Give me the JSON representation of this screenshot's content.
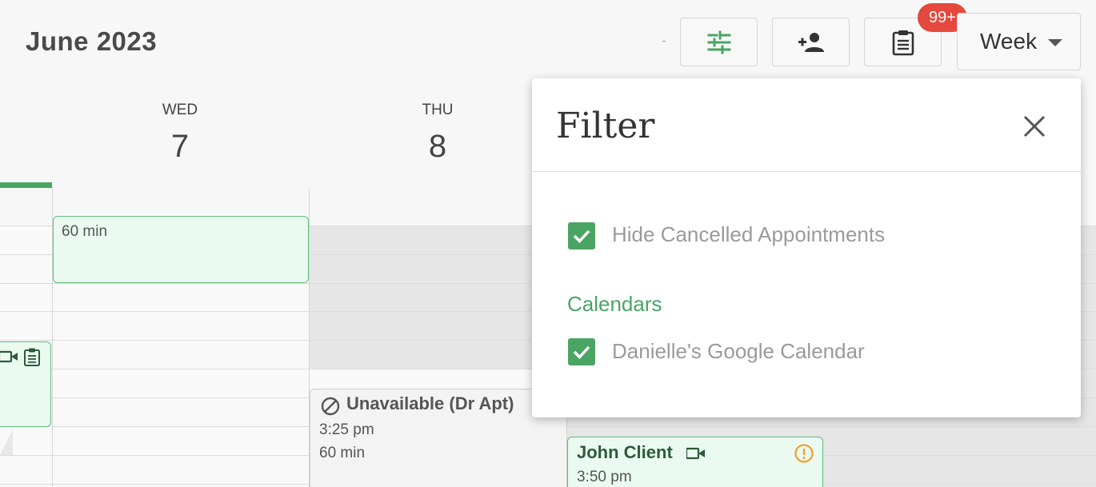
{
  "header": {
    "title": "June 2023",
    "notification_count": "99+",
    "view_selector": "Week"
  },
  "days": [
    {
      "name": "WED",
      "number": "7"
    },
    {
      "name": "THU",
      "number": "8"
    }
  ],
  "events": {
    "wed_top": {
      "duration": "60 min"
    },
    "thu_unavailable": {
      "title": "Unavailable (Dr Apt)",
      "time": "3:25 pm",
      "duration": "60 min"
    },
    "fri_john": {
      "title": "John Client",
      "time": "3:50 pm"
    }
  },
  "filter": {
    "title": "Filter",
    "hide_cancelled": {
      "label": "Hide Cancelled Appointments",
      "checked": true
    },
    "calendars_heading": "Calendars",
    "calendars": [
      {
        "label": "Danielle's Google Calendar",
        "checked": true
      }
    ]
  },
  "colors": {
    "accent": "#4aa564",
    "badge": "#e5483c",
    "event_bg": "#eafaf0",
    "warning": "#f0a030"
  }
}
